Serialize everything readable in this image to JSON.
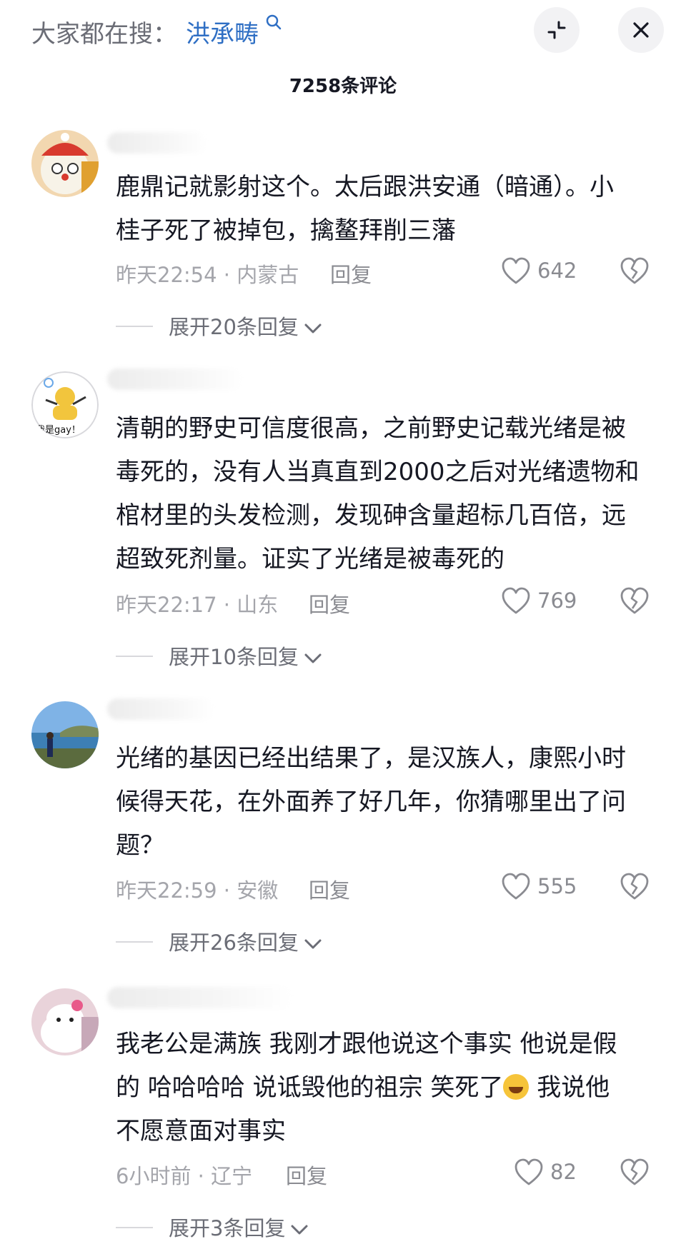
{
  "header": {
    "search_prefix": "大家都在搜：",
    "search_term": "洪承畴",
    "search_icon": "search-icon",
    "collapse_icon": "collapse-icon",
    "close_icon": "close-icon"
  },
  "comment_count": "7258条评论",
  "comments": [
    {
      "text": "鹿鼎记就影射这个。太后跟洪安通（暗通）。小\n桂子死了被掉包，擒鳌拜削三藩",
      "time": "昨天22:54 · 内蒙古",
      "reply": "回复",
      "likes": "642",
      "expand": "展开20条回复"
    },
    {
      "text": "清朝的野史可信度很高，之前野史记载光绪是被\n毒死的，没有人当真直到2000之后对光绪遗物和\n棺材里的头发检测，发现砷含量超标几百倍，远\n超致死剂量。证实了光绪是被毒死的",
      "time": "昨天22:17 · 山东",
      "reply": "回复",
      "likes": "769",
      "expand": "展开10条回复",
      "avatar_text": "我是gay！"
    },
    {
      "text": "光绪的基因已经出结果了，是汉族人，康熙小时\n候得天花，在外面养了好几年，你猜哪里出了问\n题？",
      "time": "昨天22:59 · 安徽",
      "reply": "回复",
      "likes": "555",
      "expand": "展开26条回复"
    },
    {
      "text_part1": "我老公是满族 我刚才跟他说这个事实 他说是假\n的 哈哈哈哈 说诋毁他的祖宗 笑死了",
      "text_part2": " 我说他\n不愿意面对事实",
      "time": "6小时前 · 辽宁",
      "reply": "回复",
      "likes": "82",
      "expand": "展开3条回复"
    }
  ],
  "colors": {
    "link_blue": "#2f6fc4",
    "meta_gray": "#a4a5ab",
    "text_dark": "#161823"
  }
}
